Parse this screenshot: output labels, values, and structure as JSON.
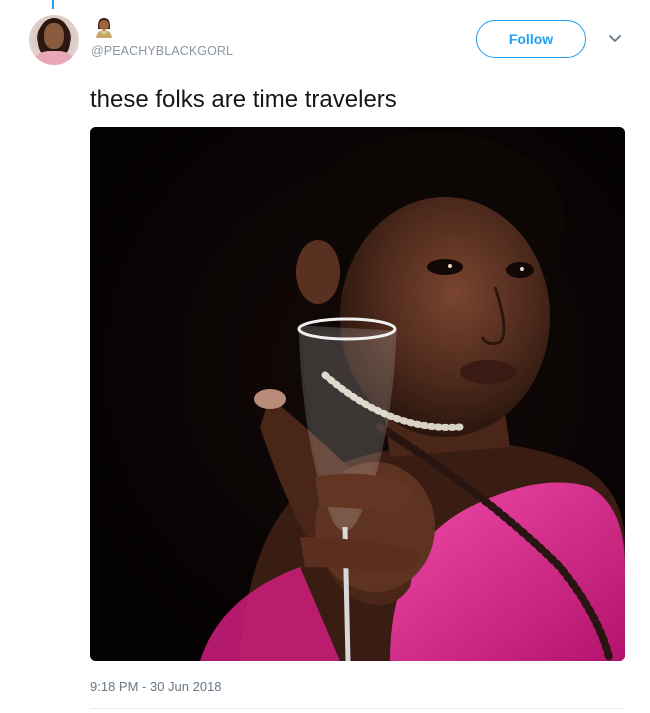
{
  "tweet": {
    "handle": "@PEACHYBLACKGORL",
    "handle_emoji": "woman-emoji-icon",
    "follow_label": "Follow",
    "text": "these folks are time travelers",
    "timestamp": "9:18 PM - 30 Jun 2018",
    "media_description_icon": "photo-girl-holding-champagne-flute"
  },
  "colors": {
    "accent": "#1da1f2",
    "text": "#14171a",
    "muted": "#657786",
    "dress": "#e0198a"
  }
}
